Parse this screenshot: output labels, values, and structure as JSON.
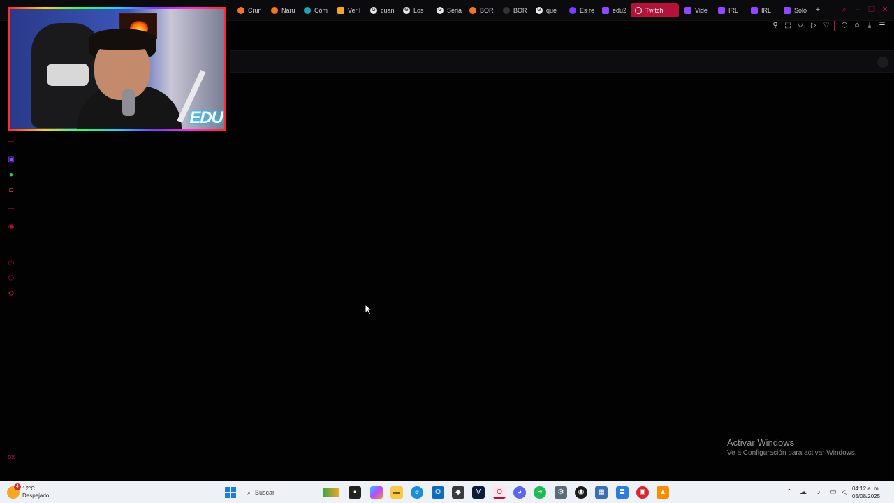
{
  "browser": {
    "tabs": [
      {
        "label": "Crun",
        "favicon": "crunchyroll-icon",
        "color": "#f47521"
      },
      {
        "label": "Naru",
        "favicon": "crunchyroll-icon",
        "color": "#f47521"
      },
      {
        "label": "Cóm",
        "favicon": "site-icon",
        "color": "#1aa6b7"
      },
      {
        "label": "Ver l",
        "favicon": "site-icon",
        "color": "#f5a623"
      },
      {
        "label": "cuan",
        "favicon": "google-icon",
        "color": "#e9e9e9"
      },
      {
        "label": "Los",
        "favicon": "google-icon",
        "color": "#e9e9e9"
      },
      {
        "label": "Seria",
        "favicon": "google-icon",
        "color": "#e9e9e9"
      },
      {
        "label": "BOR",
        "favicon": "crunchyroll-icon",
        "color": "#f47521"
      },
      {
        "label": "BOR",
        "favicon": "site-icon",
        "color": "#333333"
      },
      {
        "label": "que",
        "favicon": "google-icon",
        "color": "#e9e9e9"
      },
      {
        "label": "Es re",
        "favicon": "site-icon",
        "color": "#7a3cff"
      },
      {
        "label": "edu2",
        "favicon": "twitch-icon",
        "color": "#9146ff"
      },
      {
        "label": "Twitch",
        "favicon": "opera-icon",
        "color": "#b5123a",
        "active": true
      },
      {
        "label": "Vide",
        "favicon": "twitch-icon",
        "color": "#9146ff"
      },
      {
        "label": "IRL",
        "favicon": "twitch-icon",
        "color": "#9146ff"
      },
      {
        "label": "IRL",
        "favicon": "twitch-icon",
        "color": "#9146ff"
      },
      {
        "label": "Solo",
        "favicon": "twitch-icon",
        "color": "#9146ff"
      }
    ],
    "new_tab_glyph": "+",
    "toolbar_icons": [
      "pin-icon",
      "snapshot-icon",
      "shield-icon",
      "play-icon",
      "heart-icon",
      "extensions-icon",
      "profile-icon",
      "download-icon",
      "menu-icon"
    ]
  },
  "webcam": {
    "logo_text": "EDU"
  },
  "sidebar": {
    "items": [
      {
        "icon": "twitch-icon",
        "color": "#9146ff"
      },
      {
        "icon": "whatsapp-icon",
        "color": "#25d366"
      },
      {
        "icon": "instagram-icon",
        "color": "#e1306c"
      },
      {
        "icon": "player-icon",
        "color": "#b5123a"
      },
      {
        "icon": "history-icon",
        "color": "#b5123a"
      },
      {
        "icon": "extensions-icon",
        "color": "#b5123a"
      },
      {
        "icon": "settings-icon",
        "color": "#b5123a"
      }
    ],
    "footer_label": "GX",
    "more_glyph": "···"
  },
  "watermark": {
    "title": "Activar Windows",
    "subtitle": "Ve a Configuración para activar Windows."
  },
  "taskbar": {
    "weather": {
      "temp": "12°C",
      "condition": "Despejado",
      "badge": "4"
    },
    "search_placeholder": "Buscar",
    "clock": {
      "time": "04:12 a. m.",
      "date": "05/08/2025"
    }
  }
}
